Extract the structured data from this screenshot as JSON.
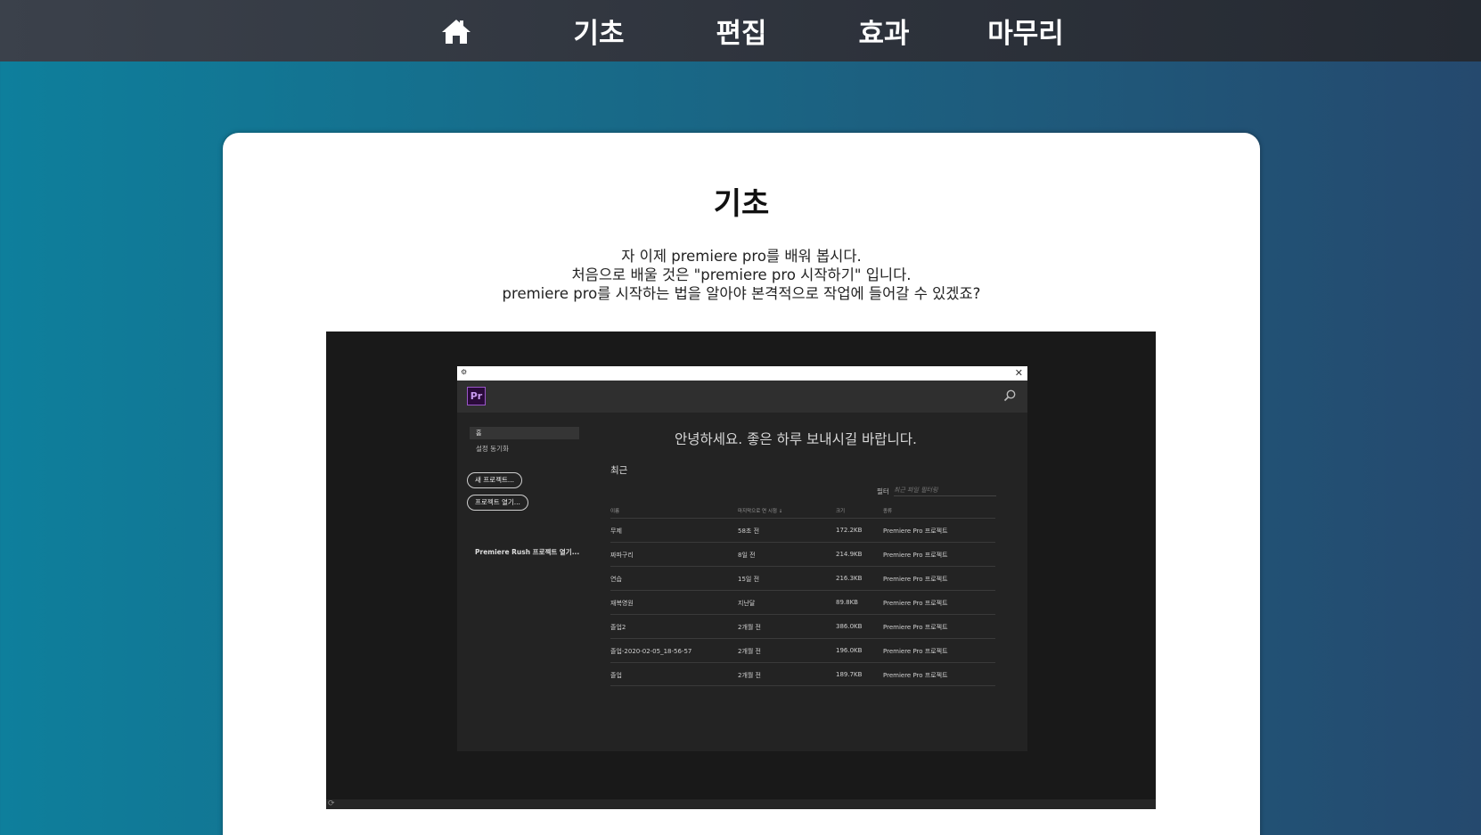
{
  "nav": {
    "home_icon": "home-icon",
    "items": [
      {
        "label": "기초"
      },
      {
        "label": "편집"
      },
      {
        "label": "효과"
      },
      {
        "label": "마무리"
      }
    ]
  },
  "content": {
    "title": "기초",
    "intro": [
      "자 이제 premiere pro를 배워 봅시다.",
      "처음으로 배울 것은 \"premiere pro 시작하기\" 입니다.",
      "premiere pro를 시작하는 법을 알아야 본격적으로 작업에 들어갈 수 있겠죠?"
    ]
  },
  "premiere": {
    "titlebar_icon": "app-icon",
    "close_glyph": "✕",
    "logo": "Pr",
    "sidebar": {
      "home": "홈",
      "sync": "설정 동기화",
      "new_project": "새 프로젝트...",
      "open_project": "프로젝트 열기...",
      "rush": "Premiere Rush 프로젝트 열기..."
    },
    "greeting": "안녕하세요. 좋은 하루 보내시길 바랍니다.",
    "recent_label": "최근",
    "filter_label": "필터",
    "filter_placeholder": "최근 파일 필터링",
    "columns": [
      "이름",
      "마지막으로 연 시점 ↓",
      "크기",
      "종류"
    ],
    "rows": [
      [
        "무제",
        "58초 전",
        "172.2KB",
        "Premiere Pro 프로젝트"
      ],
      [
        "짜파구리",
        "8일 전",
        "214.9KB",
        "Premiere Pro 프로젝트"
      ],
      [
        "연습",
        "15일 전",
        "216.3KB",
        "Premiere Pro 프로젝트"
      ],
      [
        "재복영원",
        "지난달",
        "89.8KB",
        "Premiere Pro 프로젝트"
      ],
      [
        "졸업2",
        "2개월 전",
        "386.0KB",
        "Premiere Pro 프로젝트"
      ],
      [
        "졸업-2020-02-05_18-56-57",
        "2개월 전",
        "196.0KB",
        "Premiere Pro 프로젝트"
      ],
      [
        "졸업",
        "2개월 전",
        "189.7KB",
        "Premiere Pro 프로젝트"
      ]
    ]
  }
}
